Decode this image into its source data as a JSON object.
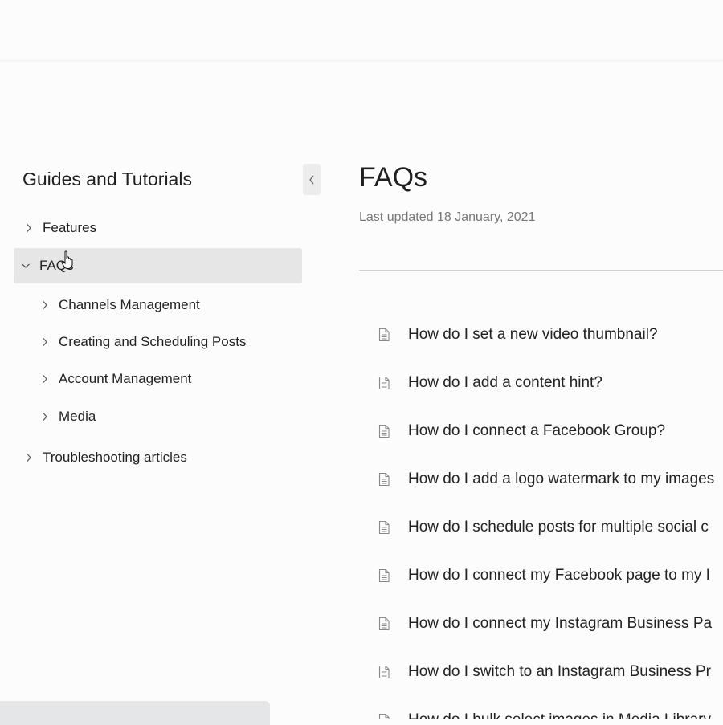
{
  "sidebar": {
    "title": "Guides and Tutorials",
    "collapse_icon": "chevron-left-icon",
    "items": [
      {
        "label": "Features",
        "expanded": false,
        "active": false,
        "level": 0
      },
      {
        "label": "FAQs",
        "expanded": true,
        "active": true,
        "level": 0
      },
      {
        "label": "Channels Management",
        "expanded": false,
        "active": false,
        "level": 1
      },
      {
        "label": "Creating and Scheduling Posts",
        "expanded": false,
        "active": false,
        "level": 1
      },
      {
        "label": "Account Management",
        "expanded": false,
        "active": false,
        "level": 1
      },
      {
        "label": "Media",
        "expanded": false,
        "active": false,
        "level": 1
      },
      {
        "label": "Troubleshooting articles",
        "expanded": false,
        "active": false,
        "level": 0
      }
    ]
  },
  "main": {
    "title": "FAQs",
    "last_updated": "Last updated 18 January, 2021",
    "article_icon": "document-icon",
    "articles": [
      "How do I set a new video thumbnail?",
      "How do I add a content hint?",
      "How do I connect a Facebook Group?",
      "How do I add a logo watermark to my images",
      "How do I schedule posts for multiple social c",
      "How do I connect my Facebook page to my I",
      "How do I connect my Instagram Business Pa",
      "How do I switch to an Instagram Business Pr",
      "How do I bulk select images in Media Library"
    ]
  },
  "colors": {
    "background": "#fcfcfc",
    "active_item_bg": "#e6e6e6",
    "muted_text": "#777777",
    "divider": "#cfcfcf"
  }
}
